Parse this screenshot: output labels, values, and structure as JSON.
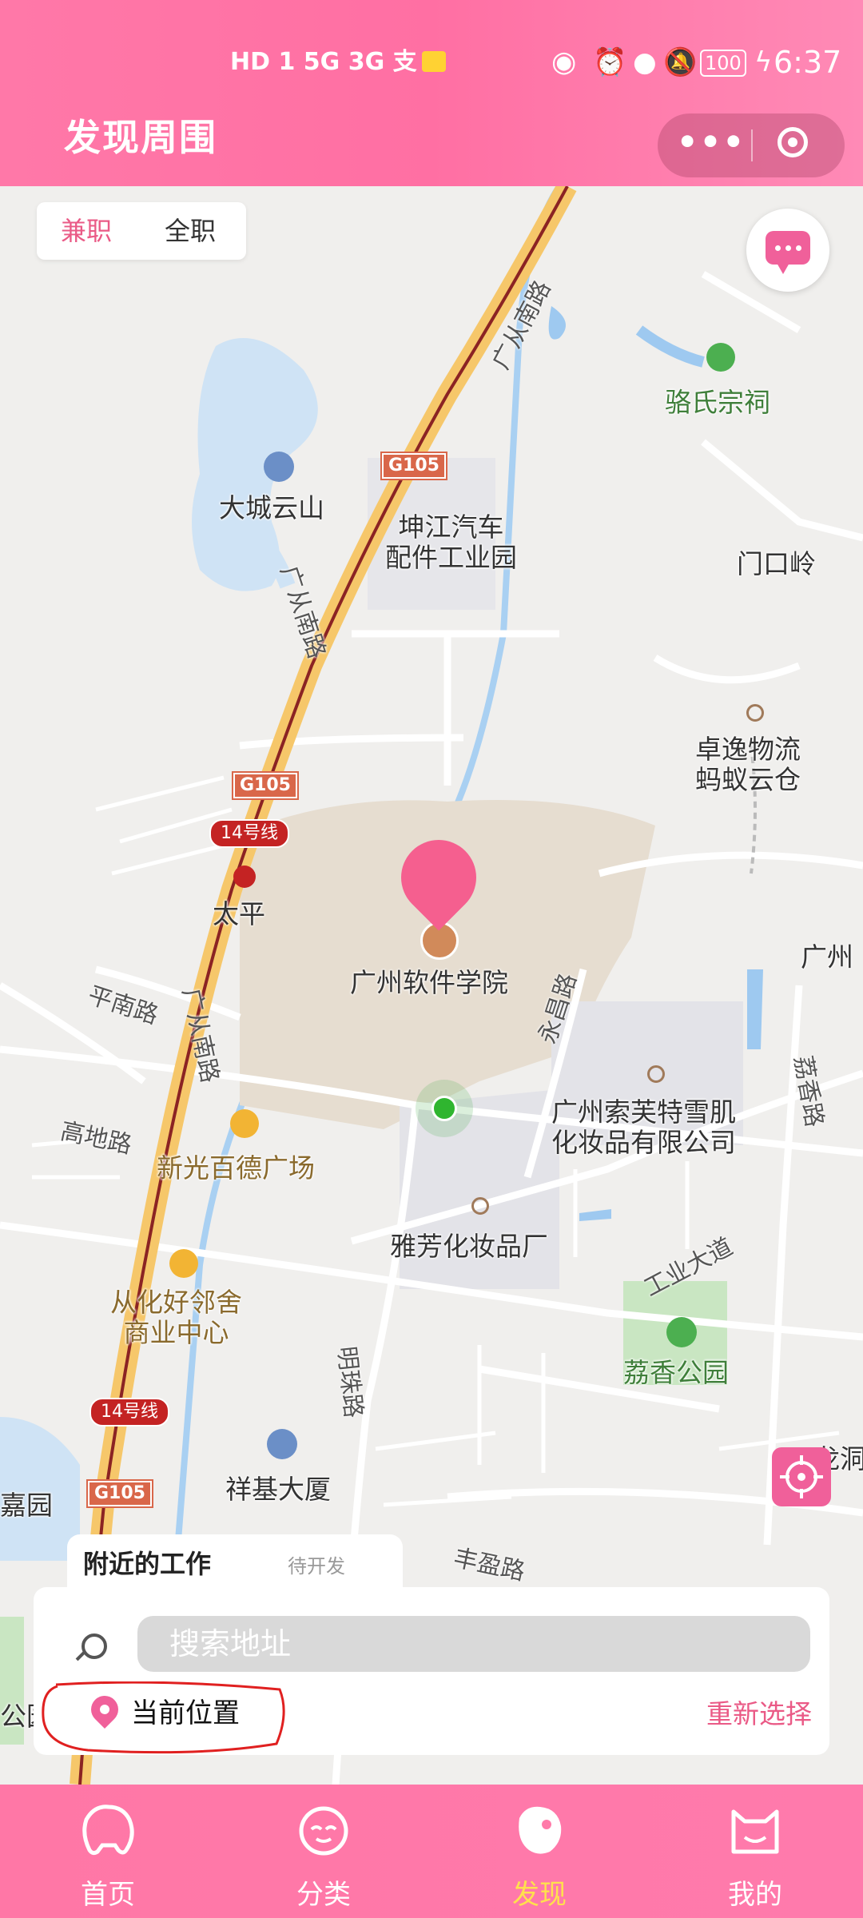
{
  "status_bar": {
    "left_icons": "HD 1  5G  3G  支",
    "battery": "100",
    "time": "6:37"
  },
  "header": {
    "title": "发现周围"
  },
  "capsule": {
    "more": "•••"
  },
  "job_tabs": {
    "part_time": "兼职",
    "full_time": "全职"
  },
  "map": {
    "labels": {
      "luoshi_temple": "骆氏宗祠",
      "dacheng_yunshan": "大城云山",
      "kunjiang": "坤江汽车\n配件工业园",
      "menkouling": "门口岭",
      "zhuoyi": "卓逸物流\n蚂蚁云仓",
      "taiping": "太平",
      "software_college": "广州软件学院",
      "guangzhou_edge": "广州",
      "suofute": "广州索芙特雪肌\n化妆品有限公司",
      "xinguang": "新光百德广场",
      "yafang": "雅芳化妆品厂",
      "conghua_haolinshe": "从化好邻舍\n商业中心",
      "lixiang_park": "荔香公园",
      "xiangji": "祥基大厦",
      "jiayuan": "嘉园",
      "park_edge": "公园",
      "longdong": "龙洞"
    },
    "roads": {
      "guangcong_1": "广从南路",
      "guangcong_2": "广从南路",
      "guangcong_3": "广从南路",
      "pingnan": "平南路",
      "gaodi": "高地路",
      "yongchang": "永昌路",
      "lixiang_rd": "荔香路",
      "gongye": "工业大道",
      "mingzhu": "明珠路",
      "fengying": "丰盈路"
    },
    "shields": {
      "g105_a": "G105",
      "g105_b": "G105",
      "g105_c": "G105",
      "metro_a": "14号线",
      "metro_b": "14号线"
    }
  },
  "nearby": {
    "title": "附近的工作",
    "pending": "待开发",
    "search_placeholder": "搜索地址",
    "current_location": "当前位置",
    "reselect": "重新选择"
  },
  "tabbar": [
    {
      "label": "首页",
      "icon": "home-mascot-icon"
    },
    {
      "label": "分类",
      "icon": "category-mascot-icon"
    },
    {
      "label": "发现",
      "icon": "discover-mascot-icon",
      "active": true
    },
    {
      "label": "我的",
      "icon": "profile-cat-icon"
    }
  ],
  "colors": {
    "brand_pink": "#ff6fa3",
    "active_tab": "#ffe14d",
    "accent_text": "#ea5a86"
  }
}
